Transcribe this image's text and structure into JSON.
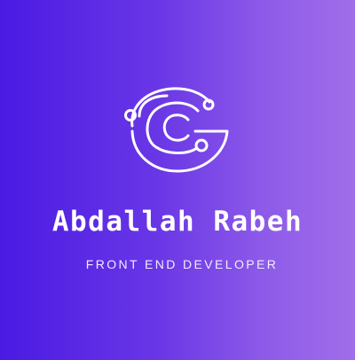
{
  "brand": {
    "name": "Abdallah Rabeh",
    "tagline": "FRONT END DEVELOPER",
    "logo_icon": "circuit-g-logo-icon"
  },
  "colors": {
    "background_start": "#4a1ae3",
    "background_end": "#a06ee9",
    "foreground": "#ffffff"
  }
}
